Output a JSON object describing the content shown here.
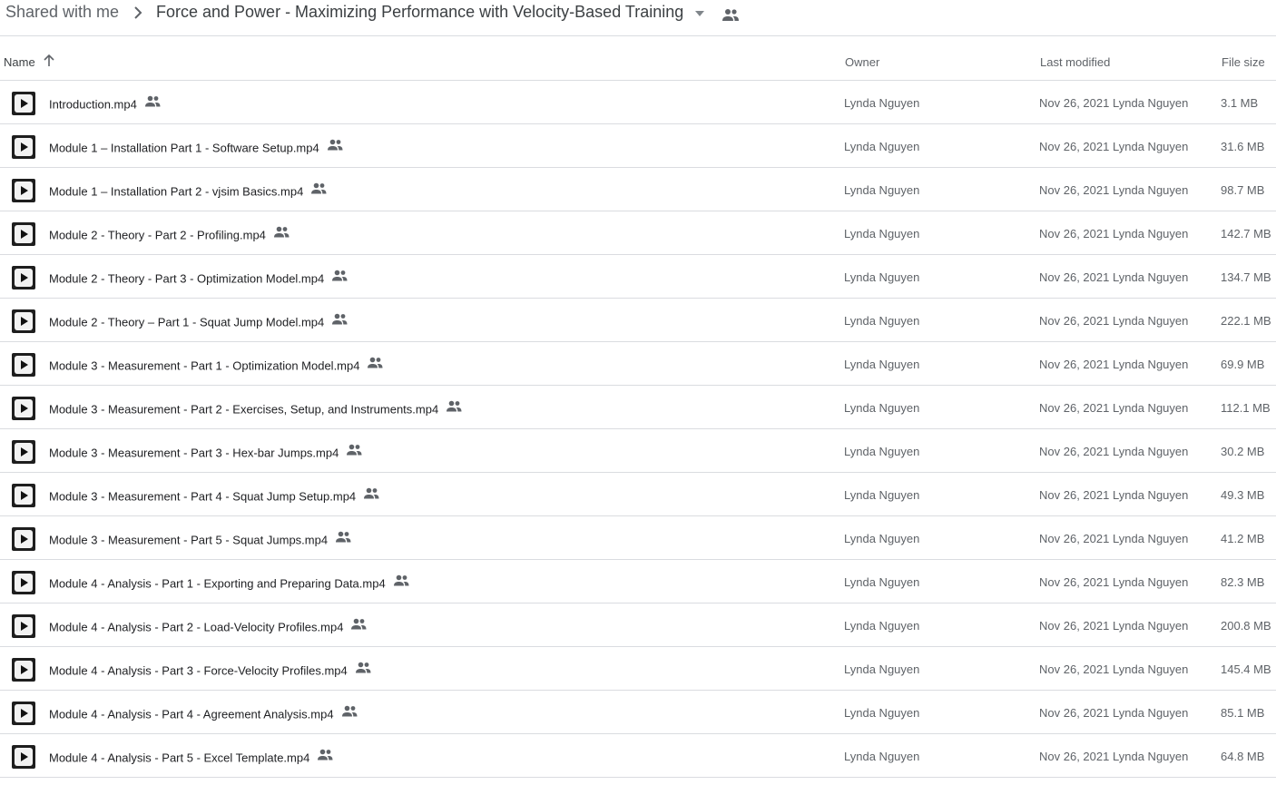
{
  "breadcrumb": {
    "root": "Shared with me",
    "current": "Force and Power - Maximizing Performance with Velocity-Based Training"
  },
  "columns": {
    "name": "Name",
    "owner": "Owner",
    "last_modified": "Last modified",
    "file_size": "File size"
  },
  "icons": {
    "separator": "chevron-right-icon",
    "dropdown": "arrow-drop-down-icon",
    "shared": "people-icon",
    "sort": "arrow-upward-icon",
    "file": "video-play-icon"
  },
  "colors": {
    "text_primary": "#202124",
    "text_secondary": "#5f6368",
    "divider": "#dadce0"
  },
  "files": [
    {
      "name": "Introduction.mp4",
      "owner": "Lynda Nguyen",
      "modified_date": "Nov 26, 2021",
      "modified_by": "Lynda Nguyen",
      "size": "3.1 MB"
    },
    {
      "name": "Module 1 – Installation Part 1 - Software Setup.mp4",
      "owner": "Lynda Nguyen",
      "modified_date": "Nov 26, 2021",
      "modified_by": "Lynda Nguyen",
      "size": "31.6 MB"
    },
    {
      "name": "Module 1 – Installation Part 2 - vjsim Basics.mp4",
      "owner": "Lynda Nguyen",
      "modified_date": "Nov 26, 2021",
      "modified_by": "Lynda Nguyen",
      "size": "98.7 MB"
    },
    {
      "name": "Module 2 - Theory - Part 2 - Profiling.mp4",
      "owner": "Lynda Nguyen",
      "modified_date": "Nov 26, 2021",
      "modified_by": "Lynda Nguyen",
      "size": "142.7 MB"
    },
    {
      "name": "Module 2 - Theory - Part 3 - Optimization Model.mp4",
      "owner": "Lynda Nguyen",
      "modified_date": "Nov 26, 2021",
      "modified_by": "Lynda Nguyen",
      "size": "134.7 MB"
    },
    {
      "name": "Module 2 - Theory – Part 1 - Squat Jump Model.mp4",
      "owner": "Lynda Nguyen",
      "modified_date": "Nov 26, 2021",
      "modified_by": "Lynda Nguyen",
      "size": "222.1 MB"
    },
    {
      "name": "Module 3 - Measurement - Part 1 - Optimization Model.mp4",
      "owner": "Lynda Nguyen",
      "modified_date": "Nov 26, 2021",
      "modified_by": "Lynda Nguyen",
      "size": "69.9 MB"
    },
    {
      "name": "Module 3 - Measurement - Part 2 - Exercises, Setup, and Instruments.mp4",
      "owner": "Lynda Nguyen",
      "modified_date": "Nov 26, 2021",
      "modified_by": "Lynda Nguyen",
      "size": "112.1 MB"
    },
    {
      "name": "Module 3 - Measurement - Part 3 - Hex-bar Jumps.mp4",
      "owner": "Lynda Nguyen",
      "modified_date": "Nov 26, 2021",
      "modified_by": "Lynda Nguyen",
      "size": "30.2 MB"
    },
    {
      "name": "Module 3 - Measurement - Part 4 - Squat Jump Setup.mp4",
      "owner": "Lynda Nguyen",
      "modified_date": "Nov 26, 2021",
      "modified_by": "Lynda Nguyen",
      "size": "49.3 MB"
    },
    {
      "name": "Module 3 - Measurement - Part 5 - Squat Jumps.mp4",
      "owner": "Lynda Nguyen",
      "modified_date": "Nov 26, 2021",
      "modified_by": "Lynda Nguyen",
      "size": "41.2 MB"
    },
    {
      "name": "Module 4 - Analysis - Part 1 - Exporting and Preparing Data.mp4",
      "owner": "Lynda Nguyen",
      "modified_date": "Nov 26, 2021",
      "modified_by": "Lynda Nguyen",
      "size": "82.3 MB"
    },
    {
      "name": "Module 4 - Analysis - Part 2 - Load-Velocity Profiles.mp4",
      "owner": "Lynda Nguyen",
      "modified_date": "Nov 26, 2021",
      "modified_by": "Lynda Nguyen",
      "size": "200.8 MB"
    },
    {
      "name": "Module 4 - Analysis - Part 3 - Force-Velocity Profiles.mp4",
      "owner": "Lynda Nguyen",
      "modified_date": "Nov 26, 2021",
      "modified_by": "Lynda Nguyen",
      "size": "145.4 MB"
    },
    {
      "name": "Module 4 - Analysis - Part 4 - Agreement Analysis.mp4",
      "owner": "Lynda Nguyen",
      "modified_date": "Nov 26, 2021",
      "modified_by": "Lynda Nguyen",
      "size": "85.1 MB"
    },
    {
      "name": "Module 4 - Analysis - Part 5 - Excel Template.mp4",
      "owner": "Lynda Nguyen",
      "modified_date": "Nov 26, 2021",
      "modified_by": "Lynda Nguyen",
      "size": "64.8 MB"
    }
  ]
}
